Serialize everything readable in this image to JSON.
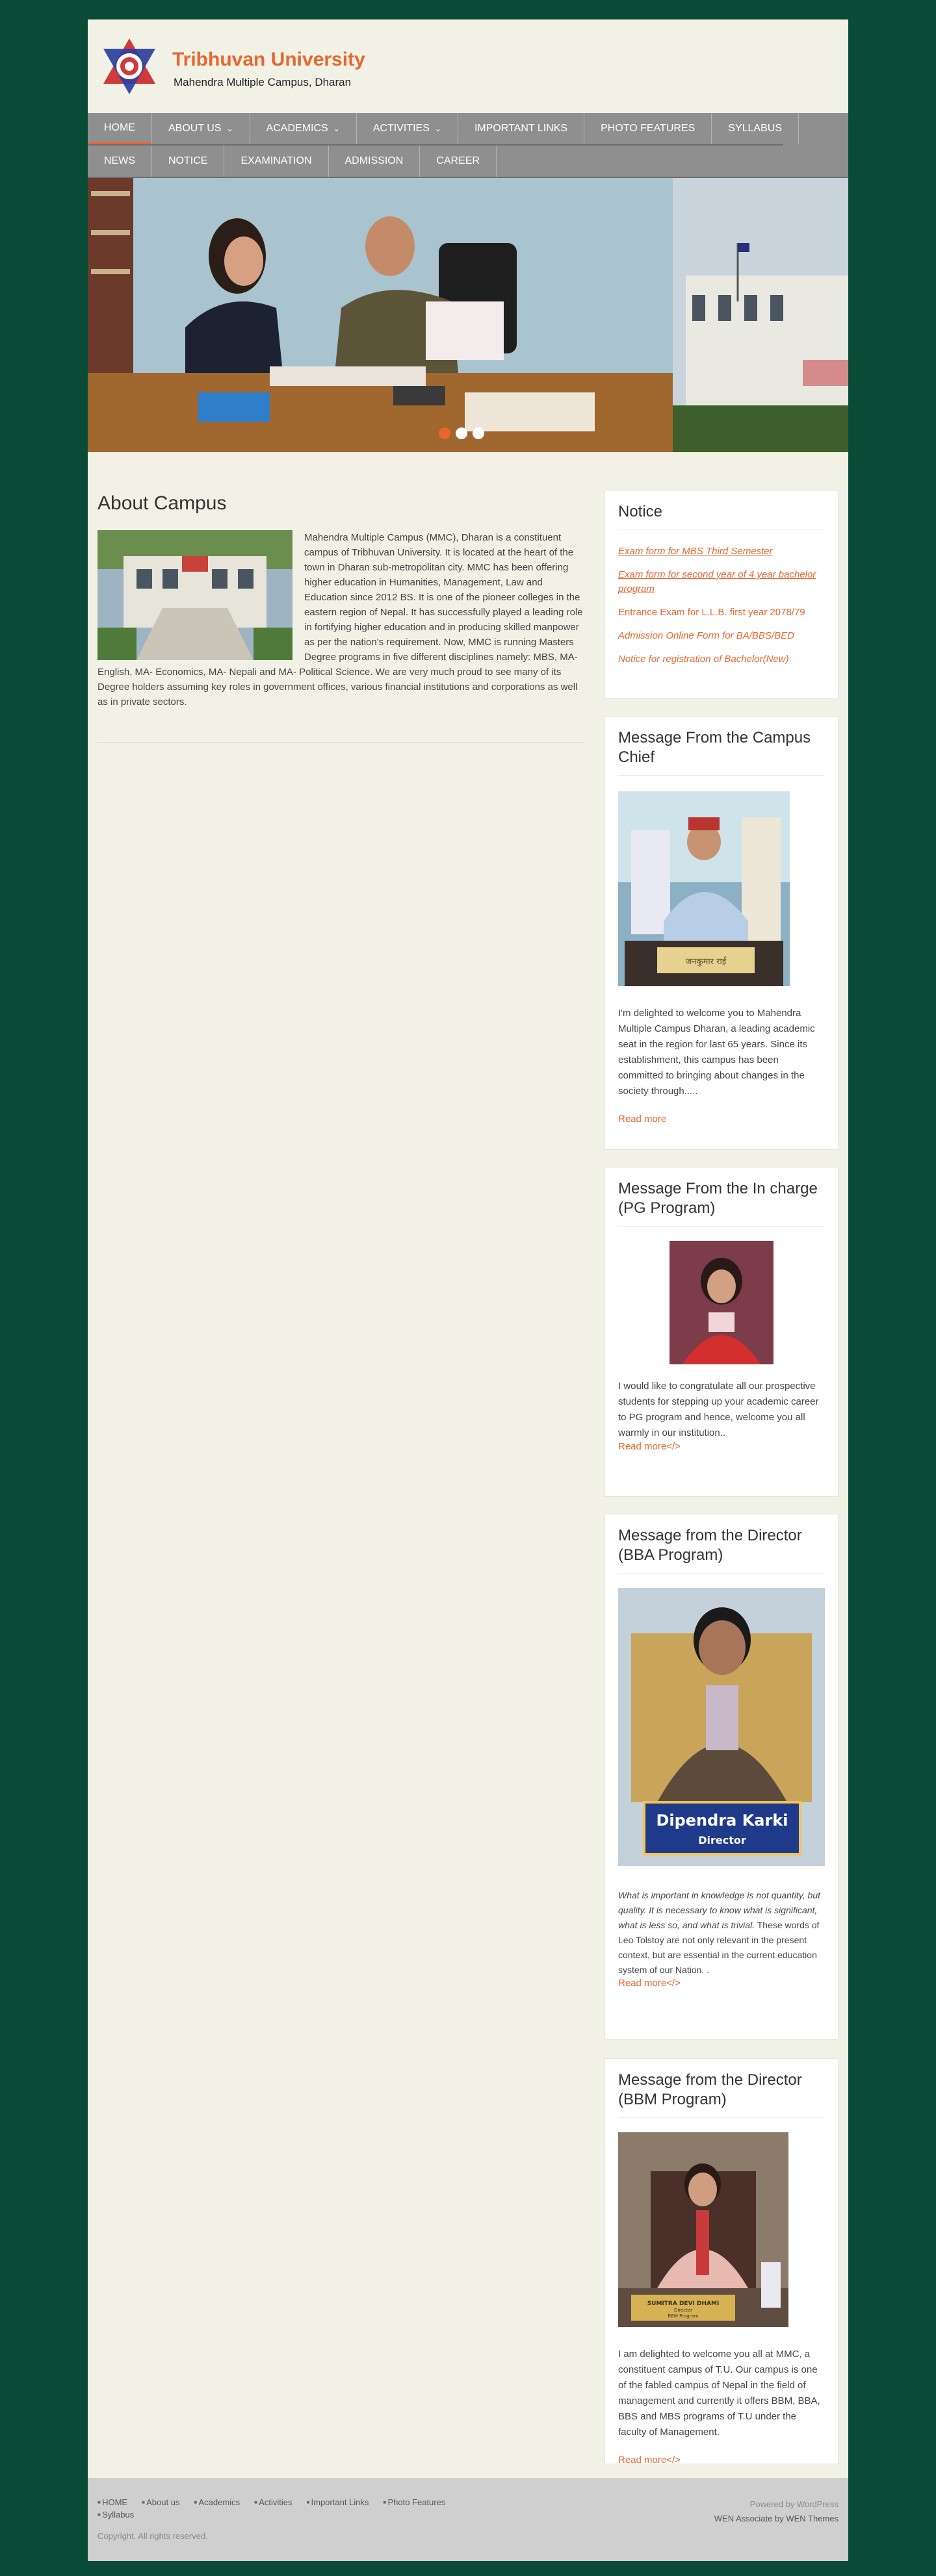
{
  "header": {
    "title": "Tribhuvan University",
    "subtitle": "Mahendra Multiple Campus, Dharan"
  },
  "nav": {
    "row1": [
      {
        "label": "HOME",
        "active": true,
        "dropdown": false
      },
      {
        "label": "ABOUT US",
        "active": false,
        "dropdown": true
      },
      {
        "label": "ACADEMICS",
        "active": false,
        "dropdown": true
      },
      {
        "label": "ACTIVITIES",
        "active": false,
        "dropdown": true
      },
      {
        "label": "IMPORTANT LINKS",
        "active": false,
        "dropdown": false
      },
      {
        "label": "PHOTO FEATURES",
        "active": false,
        "dropdown": false
      },
      {
        "label": "SYLLABUS",
        "active": false,
        "dropdown": false
      }
    ],
    "row2": [
      {
        "label": "NEWS"
      },
      {
        "label": "NOTICE"
      },
      {
        "label": "EXAMINATION"
      },
      {
        "label": "ADMISSION"
      },
      {
        "label": "CAREER"
      }
    ],
    "caret": "chevron-down-icon"
  },
  "slider": {
    "slide_count": 3,
    "active_slide": 1
  },
  "about": {
    "title": "About Campus",
    "text": "Mahendra Multiple Campus (MMC), Dharan is a constituent campus of Tribhuvan University. It is located at the heart of the town in Dharan sub-metropolitan city. MMC has been offering higher education in Humanities, Management, Law and Education since 2012 BS. It is one of the pioneer colleges in the eastern region of Nepal. It has successfully played a leading role in fortifying higher education and in producing skilled manpower as per the nation's requirement. Now, MMC is running Masters Degree programs in five different disciplines namely: MBS, MA- English, MA- Economics, MA- Nepali and MA- Political Science. We are very much proud to see many of its Degree holders assuming key roles in government offices, various financial institutions and corporations as well as in private sectors."
  },
  "notice": {
    "title": "Notice",
    "links": [
      {
        "label": "Exam form for MBS Third Semester",
        "style": "u"
      },
      {
        "label": "Exam form for second year of 4 year bachelor program",
        "style": "u"
      },
      {
        "label": "Entrance Exam for L.L.B. first year 2078/79",
        "style": ""
      },
      {
        "label": "Admission Online Form for BA/BBS/BED",
        "style": "i"
      },
      {
        "label": "Notice for registration of Bachelor(New)",
        "style": "i"
      }
    ]
  },
  "chief": {
    "title": "Message From the Campus Chief",
    "text": "I'm delighted to welcome you to Mahendra Multiple Campus Dharan, a leading academic seat in the region for last 65 years. Since its establishment, this campus has been committed to bringing about changes in the society through.....",
    "read_more": "Read more",
    "nameplate": "जनकुमार राई"
  },
  "pg": {
    "title": "Message From the In charge (PG Program)",
    "text": "I would like to congratulate all our prospective students for stepping up your academic career to PG program and hence, welcome you all warmly in our institution..",
    "read_more": "Read more</>"
  },
  "bba": {
    "title": "Message from the Director (BBA Program)",
    "quote": "What is important in knowledge is not quantity, but quality. It is necessary to know what is significant, what is less so, and what is trivial.",
    "text": "These words of Leo Tolstoy are not only relevant in the present context, but are essential in the current education system of our Nation.  .",
    "read_more": "Read more</>",
    "nameplate_name": "Dipendra Karki",
    "nameplate_role": "Director"
  },
  "bbm": {
    "title": "Message from the Director (BBM Program)",
    "text": "I am delighted to welcome you all at MMC, a constituent campus of T.U. Our campus is one of the fabled campus of Nepal in the field of management and currently it offers BBM, BBA, BBS and MBS programs of T.U under the faculty of Management.",
    "read_more": "Read more</>",
    "nameplate_name": "SUMITRA DEVI DHAMI",
    "nameplate_role": "Director",
    "nameplate_program": "BBM Program"
  },
  "footer": {
    "links": [
      "HOME",
      "About us",
      "Academics",
      "Activities",
      "Important Links",
      "Photo Features",
      "Syllabus"
    ],
    "copyright": "Copyright. All rights reserved.",
    "powered": "Powered by WordPress",
    "theme_prefix": "WEN Associate",
    "theme_by": "by WEN Themes"
  },
  "colors": {
    "accent": "#e8662e",
    "page_bg": "#0a4b38",
    "content_bg": "#f2f1e6",
    "nav_bg": "#8f8f8f"
  }
}
